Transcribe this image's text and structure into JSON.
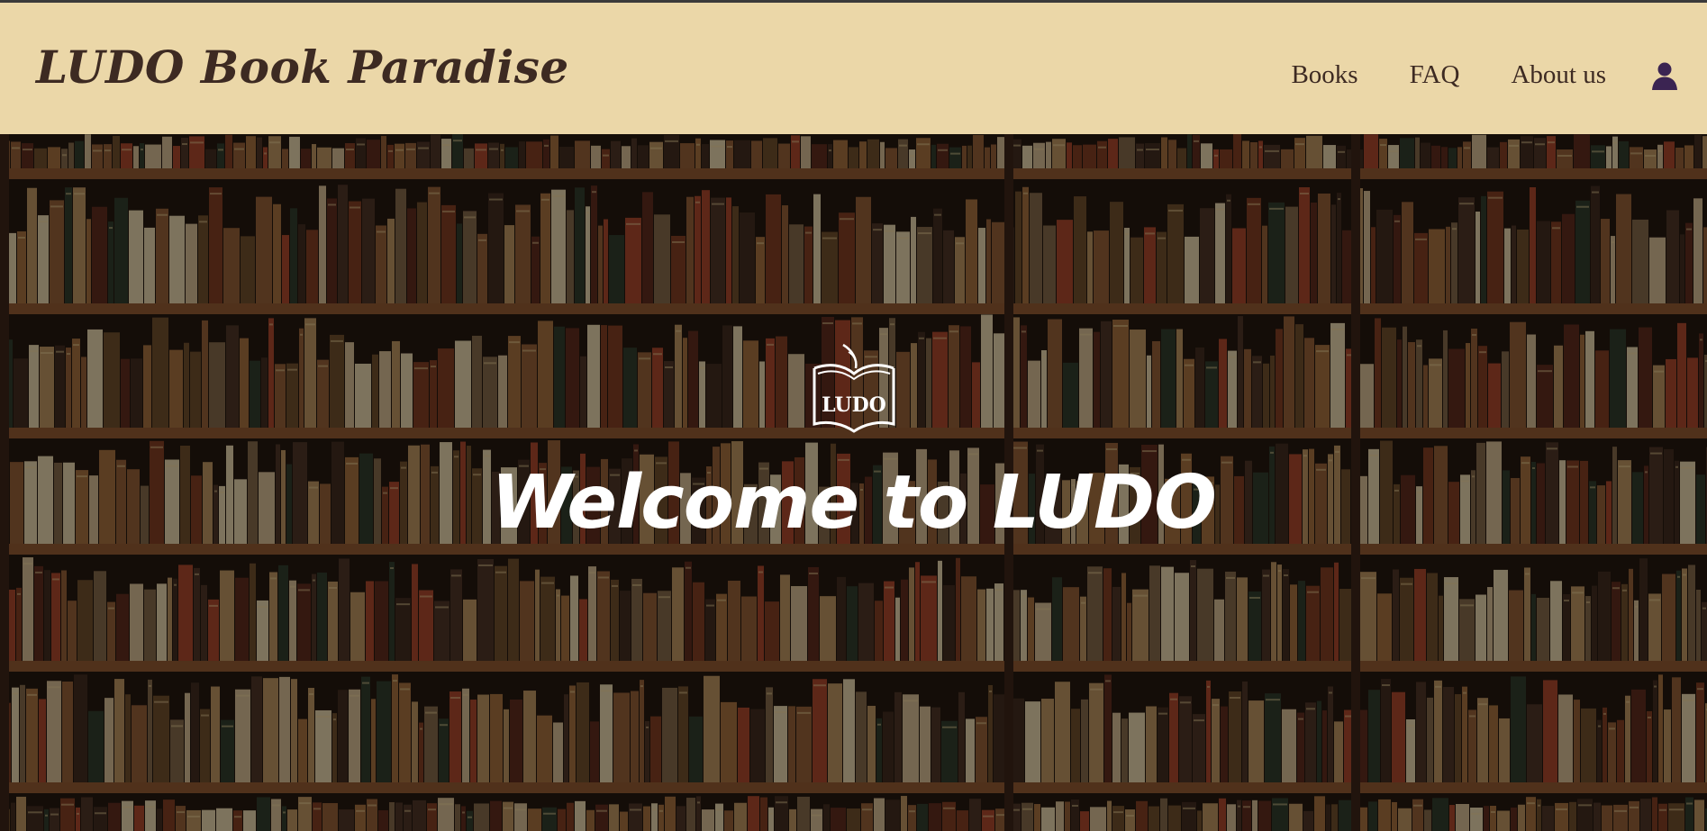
{
  "site": {
    "brand": "LUDO Book Paradise"
  },
  "nav": {
    "items": [
      {
        "label": "Books"
      },
      {
        "label": "FAQ"
      },
      {
        "label": "About us"
      }
    ],
    "account_icon": "user-icon"
  },
  "hero": {
    "logo_text": "LUDO",
    "logo_icon": "open-book-icon",
    "title": "Welcome to LUDO"
  },
  "colors": {
    "navbar_bg": "#ebd7a8",
    "text_dark": "#3d2a22",
    "accent_icon": "#3b2452"
  }
}
